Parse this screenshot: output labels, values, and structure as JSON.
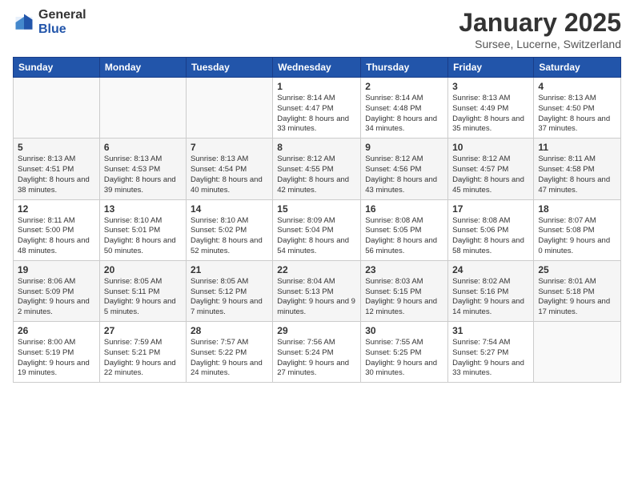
{
  "header": {
    "logo_general": "General",
    "logo_blue": "Blue",
    "title": "January 2025",
    "location": "Sursee, Lucerne, Switzerland"
  },
  "days_of_week": [
    "Sunday",
    "Monday",
    "Tuesday",
    "Wednesday",
    "Thursday",
    "Friday",
    "Saturday"
  ],
  "weeks": [
    [
      {
        "day": "",
        "info": ""
      },
      {
        "day": "",
        "info": ""
      },
      {
        "day": "",
        "info": ""
      },
      {
        "day": "1",
        "info": "Sunrise: 8:14 AM\nSunset: 4:47 PM\nDaylight: 8 hours\nand 33 minutes."
      },
      {
        "day": "2",
        "info": "Sunrise: 8:14 AM\nSunset: 4:48 PM\nDaylight: 8 hours\nand 34 minutes."
      },
      {
        "day": "3",
        "info": "Sunrise: 8:13 AM\nSunset: 4:49 PM\nDaylight: 8 hours\nand 35 minutes."
      },
      {
        "day": "4",
        "info": "Sunrise: 8:13 AM\nSunset: 4:50 PM\nDaylight: 8 hours\nand 37 minutes."
      }
    ],
    [
      {
        "day": "5",
        "info": "Sunrise: 8:13 AM\nSunset: 4:51 PM\nDaylight: 8 hours\nand 38 minutes."
      },
      {
        "day": "6",
        "info": "Sunrise: 8:13 AM\nSunset: 4:53 PM\nDaylight: 8 hours\nand 39 minutes."
      },
      {
        "day": "7",
        "info": "Sunrise: 8:13 AM\nSunset: 4:54 PM\nDaylight: 8 hours\nand 40 minutes."
      },
      {
        "day": "8",
        "info": "Sunrise: 8:12 AM\nSunset: 4:55 PM\nDaylight: 8 hours\nand 42 minutes."
      },
      {
        "day": "9",
        "info": "Sunrise: 8:12 AM\nSunset: 4:56 PM\nDaylight: 8 hours\nand 43 minutes."
      },
      {
        "day": "10",
        "info": "Sunrise: 8:12 AM\nSunset: 4:57 PM\nDaylight: 8 hours\nand 45 minutes."
      },
      {
        "day": "11",
        "info": "Sunrise: 8:11 AM\nSunset: 4:58 PM\nDaylight: 8 hours\nand 47 minutes."
      }
    ],
    [
      {
        "day": "12",
        "info": "Sunrise: 8:11 AM\nSunset: 5:00 PM\nDaylight: 8 hours\nand 48 minutes."
      },
      {
        "day": "13",
        "info": "Sunrise: 8:10 AM\nSunset: 5:01 PM\nDaylight: 8 hours\nand 50 minutes."
      },
      {
        "day": "14",
        "info": "Sunrise: 8:10 AM\nSunset: 5:02 PM\nDaylight: 8 hours\nand 52 minutes."
      },
      {
        "day": "15",
        "info": "Sunrise: 8:09 AM\nSunset: 5:04 PM\nDaylight: 8 hours\nand 54 minutes."
      },
      {
        "day": "16",
        "info": "Sunrise: 8:08 AM\nSunset: 5:05 PM\nDaylight: 8 hours\nand 56 minutes."
      },
      {
        "day": "17",
        "info": "Sunrise: 8:08 AM\nSunset: 5:06 PM\nDaylight: 8 hours\nand 58 minutes."
      },
      {
        "day": "18",
        "info": "Sunrise: 8:07 AM\nSunset: 5:08 PM\nDaylight: 9 hours\nand 0 minutes."
      }
    ],
    [
      {
        "day": "19",
        "info": "Sunrise: 8:06 AM\nSunset: 5:09 PM\nDaylight: 9 hours\nand 2 minutes."
      },
      {
        "day": "20",
        "info": "Sunrise: 8:05 AM\nSunset: 5:11 PM\nDaylight: 9 hours\nand 5 minutes."
      },
      {
        "day": "21",
        "info": "Sunrise: 8:05 AM\nSunset: 5:12 PM\nDaylight: 9 hours\nand 7 minutes."
      },
      {
        "day": "22",
        "info": "Sunrise: 8:04 AM\nSunset: 5:13 PM\nDaylight: 9 hours\nand 9 minutes."
      },
      {
        "day": "23",
        "info": "Sunrise: 8:03 AM\nSunset: 5:15 PM\nDaylight: 9 hours\nand 12 minutes."
      },
      {
        "day": "24",
        "info": "Sunrise: 8:02 AM\nSunset: 5:16 PM\nDaylight: 9 hours\nand 14 minutes."
      },
      {
        "day": "25",
        "info": "Sunrise: 8:01 AM\nSunset: 5:18 PM\nDaylight: 9 hours\nand 17 minutes."
      }
    ],
    [
      {
        "day": "26",
        "info": "Sunrise: 8:00 AM\nSunset: 5:19 PM\nDaylight: 9 hours\nand 19 minutes."
      },
      {
        "day": "27",
        "info": "Sunrise: 7:59 AM\nSunset: 5:21 PM\nDaylight: 9 hours\nand 22 minutes."
      },
      {
        "day": "28",
        "info": "Sunrise: 7:57 AM\nSunset: 5:22 PM\nDaylight: 9 hours\nand 24 minutes."
      },
      {
        "day": "29",
        "info": "Sunrise: 7:56 AM\nSunset: 5:24 PM\nDaylight: 9 hours\nand 27 minutes."
      },
      {
        "day": "30",
        "info": "Sunrise: 7:55 AM\nSunset: 5:25 PM\nDaylight: 9 hours\nand 30 minutes."
      },
      {
        "day": "31",
        "info": "Sunrise: 7:54 AM\nSunset: 5:27 PM\nDaylight: 9 hours\nand 33 minutes."
      },
      {
        "day": "",
        "info": ""
      }
    ]
  ]
}
